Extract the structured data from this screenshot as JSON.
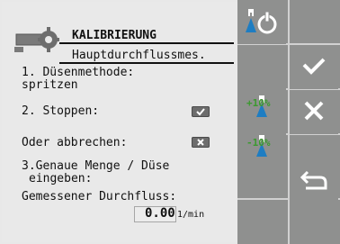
{
  "screen": {
    "title": "KALIBRIERUNG",
    "subtitle": "Hauptdurchflussmes.",
    "step1_line1": "1. Düsenmethode:",
    "step1_line2": "spritzen",
    "step2_label": "2. Stoppen:",
    "cancel_label": "Oder abbrechen:",
    "step3_line1": "3.Genaue Menge / Düse",
    "step3_line2": "eingeben:",
    "measured_label": "Gemessener Durchfluss:",
    "measured_value": "0.00",
    "measured_unit": "1/min"
  },
  "right_panel": {
    "btn_plus_label": "+10%",
    "btn_minus_label": "-10%"
  },
  "colors": {
    "panel_gray": "#8f908f",
    "screen_bg": "#e9e9e9",
    "accent_blue": "#1e7dc2",
    "accent_green": "#3b9a2f"
  }
}
